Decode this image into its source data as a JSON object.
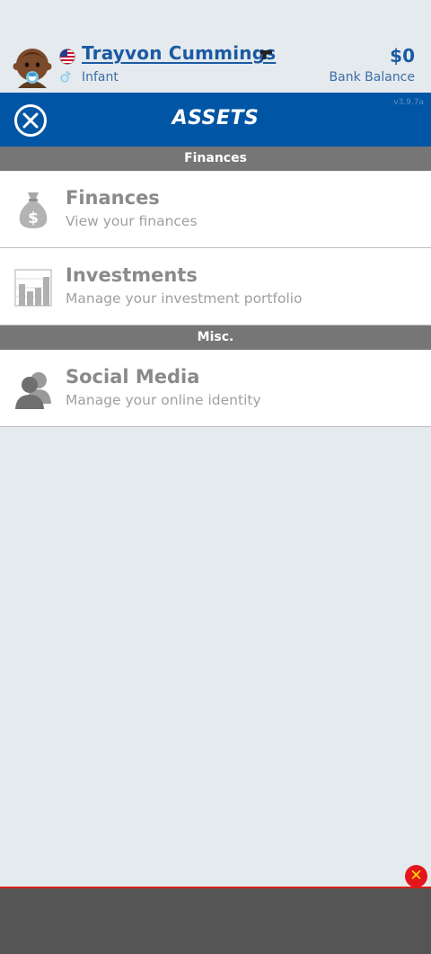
{
  "header": {
    "name": "Trayvon Cummings",
    "life_stage": "Infant",
    "balance": "$0",
    "balance_label": "Bank Balance"
  },
  "titlebar": {
    "title": "ASSETS",
    "version": "v3.9.7a"
  },
  "sections": [
    {
      "label": "Finances",
      "items": [
        {
          "title": "Finances",
          "subtitle": "View your finances",
          "icon": "money-bag-icon"
        },
        {
          "title": "Investments",
          "subtitle": "Manage your investment portfolio",
          "icon": "bar-chart-icon"
        }
      ]
    },
    {
      "label": "Misc.",
      "items": [
        {
          "title": "Social Media",
          "subtitle": "Manage your online identity",
          "icon": "people-icon"
        }
      ]
    }
  ],
  "colors": {
    "primary": "#0056a4",
    "link": "#1b5aa3",
    "section_bg": "#767676",
    "ad_close": "#e3161b"
  }
}
